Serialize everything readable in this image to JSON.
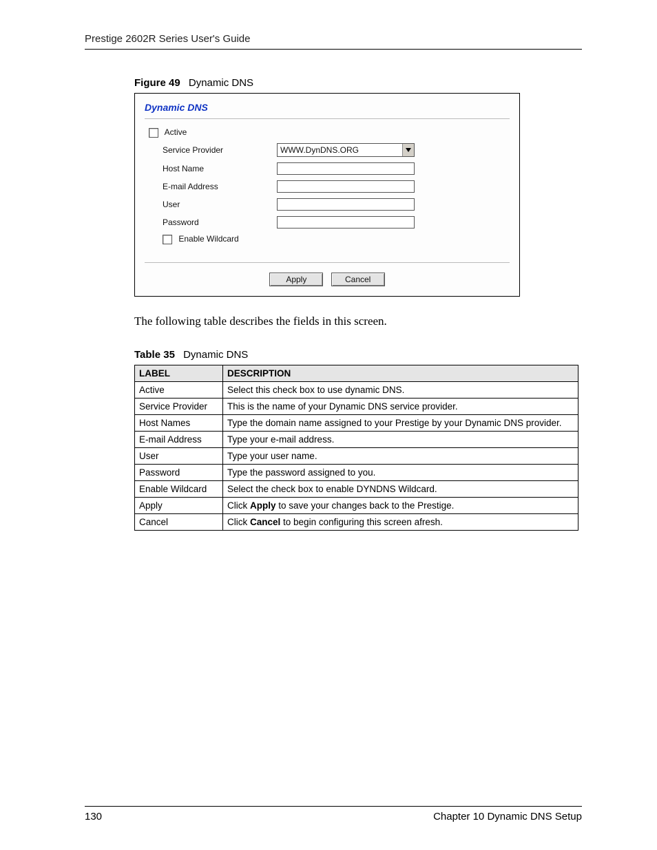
{
  "header": {
    "running_head": "Prestige 2602R Series User's Guide"
  },
  "figure": {
    "caption_bold": "Figure 49",
    "caption_rest": "Dynamic DNS",
    "title": "Dynamic DNS",
    "fields": {
      "active_label": "Active",
      "service_provider_label": "Service Provider",
      "service_provider_value": "WWW.DynDNS.ORG",
      "host_name_label": "Host Name",
      "host_name_value": "",
      "email_label": "E-mail Address",
      "email_value": "",
      "user_label": "User",
      "user_value": "",
      "password_label": "Password",
      "password_value": "",
      "enable_wildcard_label": "Enable Wildcard"
    },
    "buttons": {
      "apply": "Apply",
      "cancel": "Cancel"
    }
  },
  "body_text": "The following table describes the fields in this screen.",
  "table": {
    "caption_bold": "Table 35",
    "caption_rest": "Dynamic DNS",
    "headers": {
      "label": "LABEL",
      "description": "DESCRIPTION"
    },
    "rows": [
      {
        "label": "Active",
        "desc_pre": "Select this check box to use dynamic DNS.",
        "desc_bold": "",
        "desc_post": ""
      },
      {
        "label": "Service Provider",
        "desc_pre": "This is the name of your Dynamic DNS service provider.",
        "desc_bold": "",
        "desc_post": ""
      },
      {
        "label": "Host Names",
        "desc_pre": "Type the domain name assigned to your Prestige by your Dynamic DNS provider.",
        "desc_bold": "",
        "desc_post": ""
      },
      {
        "label": "E-mail Address",
        "desc_pre": "Type your e-mail address.",
        "desc_bold": "",
        "desc_post": ""
      },
      {
        "label": "User",
        "desc_pre": "Type your user name.",
        "desc_bold": "",
        "desc_post": ""
      },
      {
        "label": "Password",
        "desc_pre": "Type the password assigned to you.",
        "desc_bold": "",
        "desc_post": ""
      },
      {
        "label": "Enable Wildcard",
        "desc_pre": "Select the check box to enable DYNDNS Wildcard.",
        "desc_bold": "",
        "desc_post": ""
      },
      {
        "label": "Apply",
        "desc_pre": "Click ",
        "desc_bold": "Apply",
        "desc_post": " to save your changes back to the Prestige."
      },
      {
        "label": "Cancel",
        "desc_pre": "Click ",
        "desc_bold": "Cancel",
        "desc_post": " to begin configuring this screen afresh."
      }
    ]
  },
  "footer": {
    "page_number": "130",
    "chapter": "Chapter 10 Dynamic DNS Setup"
  }
}
